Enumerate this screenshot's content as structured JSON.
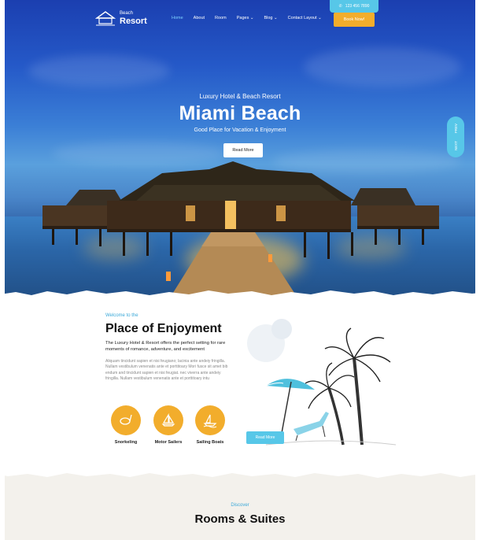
{
  "brand": {
    "small": "Beach",
    "big": "Resort"
  },
  "nav": {
    "items": [
      {
        "label": "Home",
        "active": true
      },
      {
        "label": "About"
      },
      {
        "label": "Room"
      },
      {
        "label": "Pages ⌄"
      },
      {
        "label": "Blog ⌄"
      },
      {
        "label": "Contact Layout ⌄"
      }
    ],
    "phone": "123 456 7890",
    "book_label": "Book Now!"
  },
  "hero": {
    "subtitle": "Luxury Hotel & Beach Resort",
    "title": "Miami Beach",
    "tagline": "Good Place for Vacation & Enjoyment",
    "button": "Read More",
    "side_prev": "PREV",
    "side_next": "NEXT"
  },
  "about": {
    "kicker": "Welcome to the",
    "title": "Place of Enjoyment",
    "lead": "The Luxury Hotel & Resort offers the perfect setting for rare moments of romance, adventure, and excitement",
    "body": "Aliquam tincidunt sapien et nisi feugiano; lacinia ante andeiy fringilla. Nullam vestibulum venenatis ante et porttitoary Mori fusce sit amet bib endum and tincidunt sapien et nisi feugiat. nec viverra ante andeiy fringilla. Nullam vestibulum venenatis ante et porttitoary intu",
    "features": [
      {
        "label": "Snorkeling",
        "icon": "snorkel-icon"
      },
      {
        "label": "Motor Sailers",
        "icon": "sailboat-icon"
      },
      {
        "label": "Sailing Boats",
        "icon": "boat-icon"
      }
    ],
    "button": "Read More"
  },
  "rooms": {
    "kicker": "Discover",
    "title": "Rooms & Suites"
  },
  "colors": {
    "accent": "#57c7e8",
    "orange": "#f2ad2c"
  }
}
